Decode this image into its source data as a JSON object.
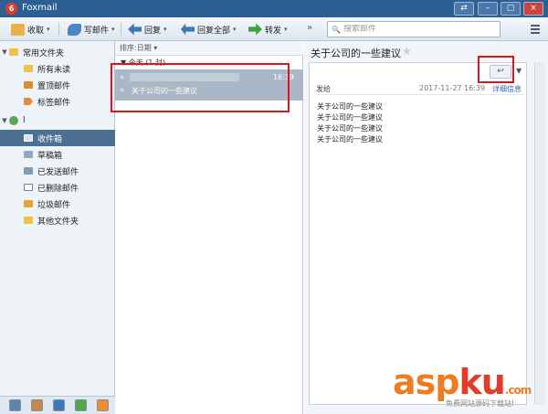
{
  "window": {
    "title": "Foxmail",
    "logo_text": "6",
    "restore_glyph": "⇄",
    "minimize_glyph": "–",
    "maximize_glyph": "▢",
    "close_glyph": "×"
  },
  "toolbar": {
    "receive_label": "收取",
    "compose_label": "写邮件",
    "reply_label": "回复",
    "reply_all_label": "回复全部",
    "forward_label": "转发",
    "more_glyph": "»",
    "search_placeholder": "搜索邮件",
    "caret": "▾",
    "search_glyph": "🔍"
  },
  "sidebar": {
    "common_folder": "常用文件夹",
    "common_items": [
      "所有未读",
      "置顶邮件",
      "标签邮件"
    ],
    "account_name": "l",
    "account_items": [
      "收件箱",
      "草稿箱",
      "已发送邮件",
      "已删除邮件",
      "垃圾邮件",
      "其他文件夹"
    ],
    "expand_glyph": "▼"
  },
  "list": {
    "sort_label": "排序:日期",
    "sort_caret": "▾",
    "group_label": "今天 (1 封)",
    "group_glyph": "▼",
    "item": {
      "time": "16:39",
      "subject": "关于公司的一些建议",
      "star": "★"
    }
  },
  "reader": {
    "subject": "关于公司的一些建议",
    "star": "★",
    "reply_glyph": "↩",
    "dropdown_glyph": "▼",
    "recipient_label": "发给",
    "date": "2017-11-27 16:39",
    "detail_link": "详细信息",
    "body_lines": [
      "关于公司的一些建议",
      "关于公司的一些建议",
      "关于公司的一些建议",
      "关于公司的一些建议"
    ]
  },
  "watermark": {
    "big": "asp",
    "u": "ku",
    "tld": ".com",
    "small": "免费网站源码下载站!"
  },
  "colors": {
    "titlebar": "#2c5f93",
    "selected": "#4d6f92",
    "highlight_box": "#e0141a",
    "accent": "#f07c22"
  }
}
